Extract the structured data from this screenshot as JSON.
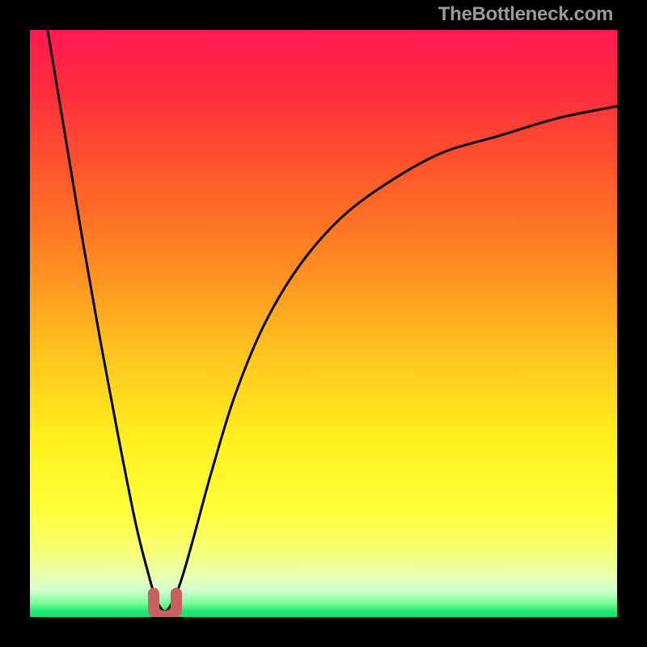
{
  "watermark": "TheBottleneck.com",
  "colors": {
    "frame": "#000000",
    "gradient_stops": [
      {
        "offset": 0.0,
        "color": "#ff1a51"
      },
      {
        "offset": 0.1,
        "color": "#ff2b3e"
      },
      {
        "offset": 0.25,
        "color": "#ff5a2a"
      },
      {
        "offset": 0.4,
        "color": "#ff8a22"
      },
      {
        "offset": 0.55,
        "color": "#ffc41e"
      },
      {
        "offset": 0.7,
        "color": "#fff01e"
      },
      {
        "offset": 0.82,
        "color": "#ffff3a"
      },
      {
        "offset": 0.89,
        "color": "#f7ff7a"
      },
      {
        "offset": 0.93,
        "color": "#e8ffb0"
      },
      {
        "offset": 0.955,
        "color": "#d0ffd0"
      },
      {
        "offset": 0.975,
        "color": "#80ff9a"
      },
      {
        "offset": 0.99,
        "color": "#20e874"
      },
      {
        "offset": 1.0,
        "color": "#18e06e"
      }
    ],
    "curve": "#000000",
    "marker_fill": "#c86060",
    "marker_stroke": "#b24a4a"
  },
  "chart_data": {
    "type": "line",
    "title": "",
    "xlabel": "",
    "ylabel": "",
    "xlim": [
      0,
      100
    ],
    "ylim": [
      0,
      100
    ],
    "notes": "Heat-gradient background (red=worst at top to green=best at bottom). A single black curve plunges from top-left to a minimum near x≈23 then rises asymptotically toward the upper right. The minimum is highlighted with a small pink U-shaped marker near the bottom.",
    "series": [
      {
        "name": "bottleneck-curve",
        "x": [
          3,
          6,
          9,
          12,
          15,
          18,
          20,
          21.5,
          23,
          24.5,
          26,
          28,
          31,
          35,
          40,
          46,
          53,
          61,
          70,
          80,
          90,
          100
        ],
        "y": [
          100,
          82,
          64,
          47,
          31,
          16,
          8,
          3,
          1,
          3,
          7,
          14,
          25,
          38,
          50,
          60,
          68,
          74,
          79,
          82,
          85,
          87
        ]
      }
    ],
    "minimum_marker": {
      "x": 23,
      "y": 1
    }
  }
}
